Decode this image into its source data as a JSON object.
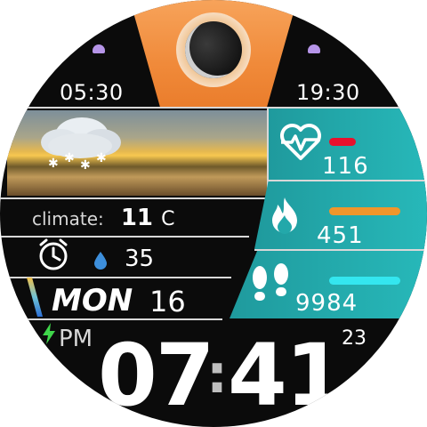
{
  "sun": {
    "sunrise": "05:30",
    "sunset": "19:30"
  },
  "moon": {
    "icon": "moon-phase-icon"
  },
  "weather": {
    "icon": "snow-cloud-icon"
  },
  "climate": {
    "label": "climate:",
    "temp": "11",
    "unit": "C"
  },
  "alarm": {
    "icon": "alarm-clock-icon"
  },
  "humidity": {
    "icon": "water-drop-icon",
    "value": "35"
  },
  "date": {
    "weekday": "MON",
    "day": "16"
  },
  "battery": {
    "icon": "charging-bolt-icon"
  },
  "metrics": {
    "heart": {
      "icon": "heart-rate-icon",
      "value": "116",
      "bar_color": "#e8112d"
    },
    "calories": {
      "icon": "flame-icon",
      "value": "451",
      "bar_color": "#f0962b"
    },
    "steps": {
      "icon": "footsteps-icon",
      "value": "9984",
      "bar_color": "#34e6ef"
    }
  },
  "clock": {
    "ampm": "PM",
    "hours": "07",
    "minutes": "41",
    "separator": ":",
    "seconds": "23"
  },
  "colors": {
    "accent_orange": "#f08a3a",
    "teal": "#27b8b9",
    "dot_lilac": "#b695e8"
  }
}
